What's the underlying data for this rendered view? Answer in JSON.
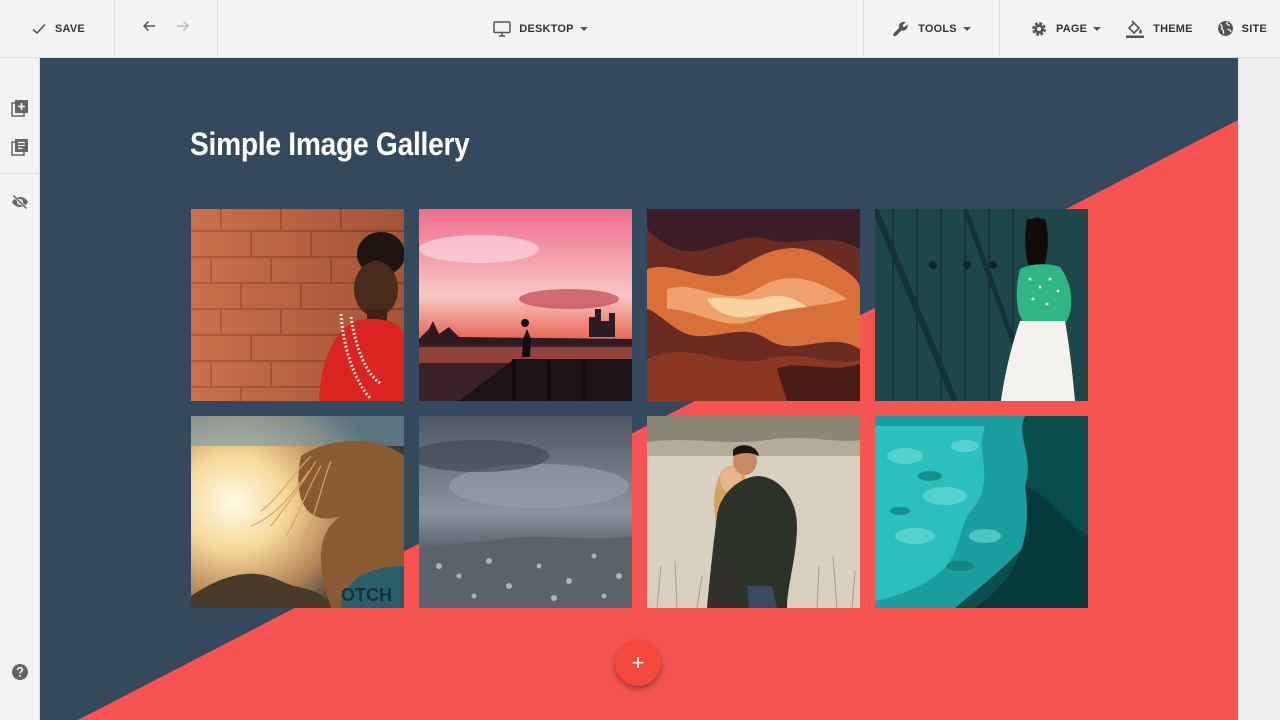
{
  "toolbar": {
    "save_label": "SAVE",
    "view_label": "DESKTOP",
    "tools_label": "TOOLS",
    "page_label": "PAGE",
    "theme_label": "THEME",
    "site_label": "SITE"
  },
  "sidebar": {
    "items": [
      {
        "icon": "add-block-icon"
      },
      {
        "icon": "library-icon"
      },
      {
        "icon": "visibility-off-icon"
      },
      {
        "icon": "help-icon"
      }
    ]
  },
  "gallery": {
    "title": "Simple Image Gallery",
    "images": [
      {
        "subject": "woman-red-brick-wall"
      },
      {
        "subject": "sunset-city-silhouette"
      },
      {
        "subject": "antelope-canyon"
      },
      {
        "subject": "woman-green-blouse-door"
      },
      {
        "subject": "hair-sunlight"
      },
      {
        "subject": "stormy-sky-forest"
      },
      {
        "subject": "couple-field"
      },
      {
        "subject": "turquoise-water"
      }
    ],
    "add_button_label": "+"
  },
  "colors": {
    "canvas_dark": "#34495e",
    "canvas_accent": "#f55451",
    "fab": "#f4483d",
    "toolbar_bg": "#f4f4f4"
  }
}
